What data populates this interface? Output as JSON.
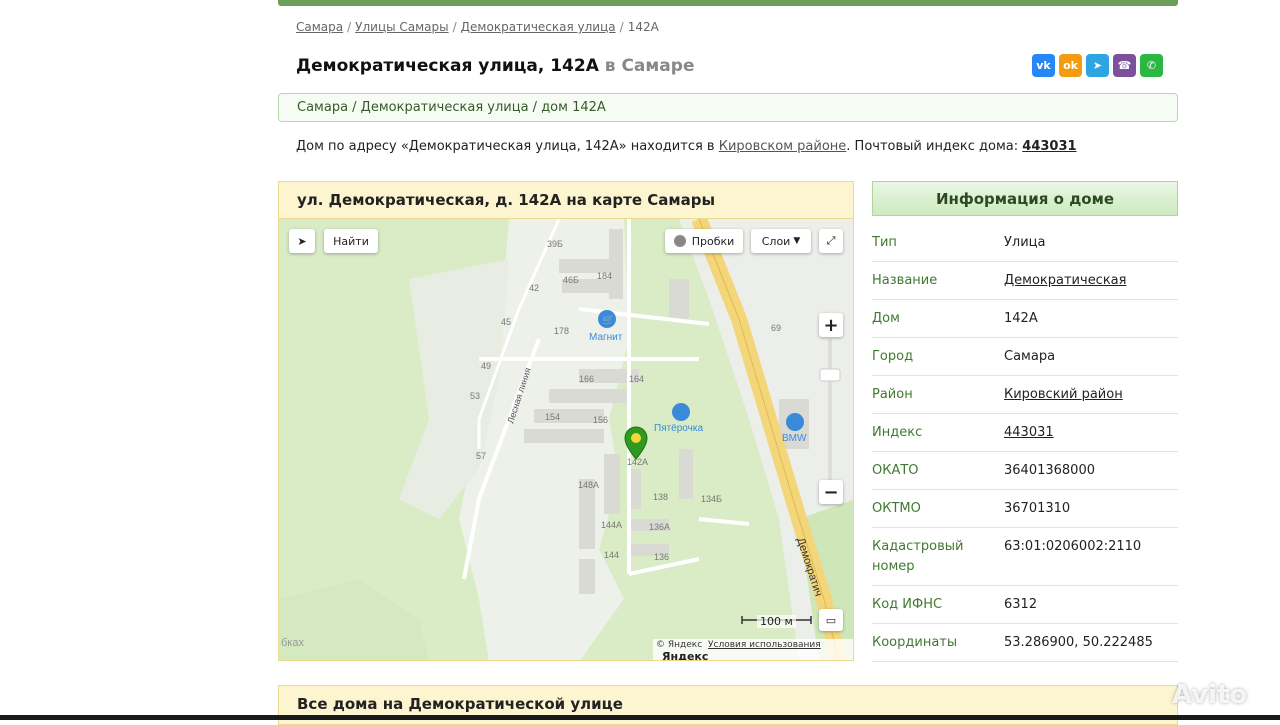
{
  "breadcrumb": {
    "items": [
      "Самара",
      "Улицы Самары",
      "Демократическая улица"
    ],
    "current": "142А",
    "sep": "/"
  },
  "header": {
    "title": "Демократическая улица, 142А",
    "city_suffix": "в Самаре"
  },
  "social": [
    {
      "name": "vk",
      "label": "vk",
      "color": "#2787f5"
    },
    {
      "name": "ok",
      "label": "ok",
      "color": "#f39c12"
    },
    {
      "name": "telegram",
      "label": "➤",
      "color": "#2ca5e0"
    },
    {
      "name": "viber",
      "label": "☎",
      "color": "#7b519d"
    },
    {
      "name": "whatsapp",
      "label": "✆",
      "color": "#2cb742"
    }
  ],
  "address_path": "Самара / Демократическая улица / дом 142А",
  "description": {
    "before": "Дом по адресу «Демократическая улица, 142А» находится в ",
    "district_link": "Кировском районе",
    "middle": ". Почтовый индекс дома: ",
    "index_link": "443031"
  },
  "map_section": {
    "title": "ул. Демократическая, д. 142А на карте Самары",
    "find_button": "Найти",
    "traffic_button": "Пробки",
    "layers_button": "Слои",
    "scale": "100 м",
    "copyright": "© Яндекс",
    "terms": "Условия использования",
    "logo": "Яндекс",
    "pois": {
      "magnit": "Магнит",
      "pyaterochka": "Пятёрочка",
      "bmw": "BMW"
    },
    "street_labels": {
      "lesnaya": "Лесная линия",
      "demokraticheskaya": "Демократич",
      "partial": "бках"
    },
    "house_numbers": [
      "39Б",
      "46Б",
      "42",
      "184",
      "45",
      "178",
      "69",
      "49",
      "166",
      "164",
      "53",
      "154",
      "156",
      "57",
      "142А",
      "148А",
      "138",
      "134Б",
      "144А",
      "136А",
      "144",
      "136"
    ]
  },
  "info": {
    "title": "Информация о доме",
    "rows": [
      {
        "key": "Тип",
        "value": "Улица",
        "link": false
      },
      {
        "key": "Название",
        "value": "Демократическая",
        "link": true
      },
      {
        "key": "Дом",
        "value": "142А",
        "link": false
      },
      {
        "key": "Город",
        "value": "Самара",
        "link": false
      },
      {
        "key": "Район",
        "value": "Кировский район",
        "link": true
      },
      {
        "key": "Индекс",
        "value": "443031",
        "link": true
      },
      {
        "key": "ОКАТО",
        "value": "36401368000",
        "link": false
      },
      {
        "key": "ОКТМО",
        "value": "36701310",
        "link": false
      },
      {
        "key": "Кадастровый номер",
        "value": "63:01:0206002:2110",
        "link": false
      },
      {
        "key": "Код ИФНС",
        "value": "6312",
        "link": false
      },
      {
        "key": "Координаты",
        "value": "53.286900, 50.222485",
        "link": false
      }
    ]
  },
  "all_houses_title": "Все дома на Демократической улице",
  "watermark": "Avito"
}
